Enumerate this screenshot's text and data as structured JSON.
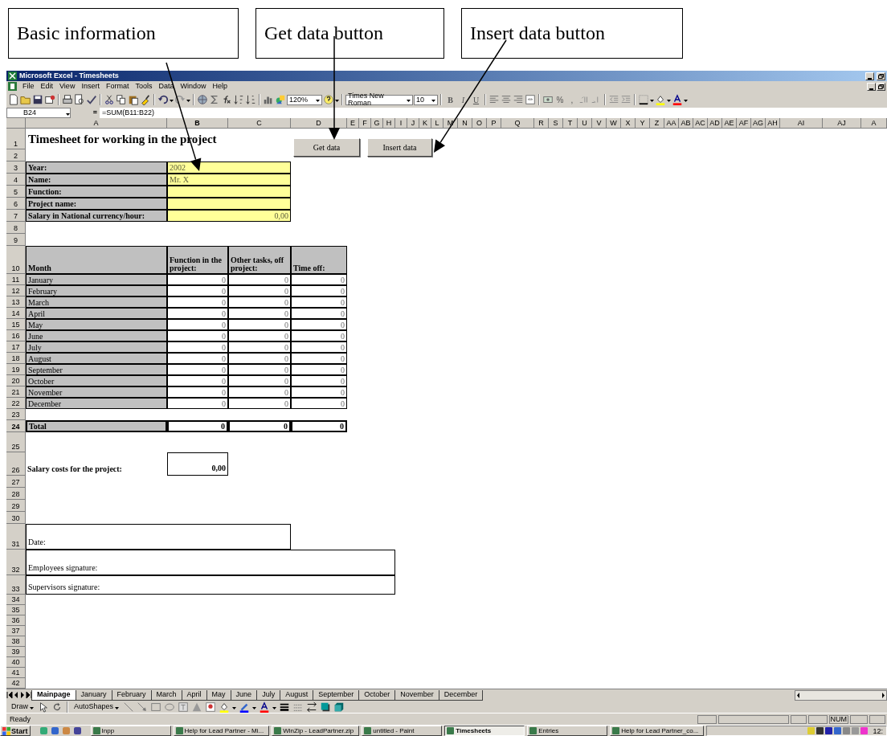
{
  "callouts": [
    {
      "text": "Basic information"
    },
    {
      "text": "Get data button"
    },
    {
      "text": "Insert data button"
    }
  ],
  "window": {
    "title": "Microsoft Excel - Timesheets"
  },
  "menu": [
    "File",
    "Edit",
    "View",
    "Insert",
    "Format",
    "Tools",
    "Data",
    "Window",
    "Help"
  ],
  "toolbar": {
    "zoom": "120%",
    "font": "Times New Roman",
    "font_size": "10",
    "format_buttons": [
      "B",
      "I",
      "U"
    ],
    "number_buttons": [
      "%",
      ","
    ]
  },
  "formula_bar": {
    "name_box": "B24",
    "equals": "=",
    "formula": "=SUM(B11:B22)"
  },
  "columns": [
    {
      "label": "A",
      "selected": false
    },
    {
      "label": "B",
      "selected": true
    },
    {
      "label": "C",
      "selected": false
    },
    {
      "label": "D",
      "selected": false
    },
    {
      "label": "E",
      "selected": false
    },
    {
      "label": "F",
      "selected": false
    },
    {
      "label": "G",
      "selected": false
    },
    {
      "label": "H",
      "selected": false
    },
    {
      "label": "I",
      "selected": false
    },
    {
      "label": "J",
      "selected": false
    },
    {
      "label": "K",
      "selected": false
    },
    {
      "label": "L",
      "selected": false
    },
    {
      "label": "M",
      "selected": false
    },
    {
      "label": "N",
      "selected": false
    },
    {
      "label": "O",
      "selected": false
    },
    {
      "label": "P",
      "selected": false
    },
    {
      "label": "Q",
      "selected": false
    },
    {
      "label": "R",
      "selected": false
    },
    {
      "label": "S",
      "selected": false
    },
    {
      "label": "T",
      "selected": false
    },
    {
      "label": "U",
      "selected": false
    },
    {
      "label": "V",
      "selected": false
    },
    {
      "label": "W",
      "selected": false
    },
    {
      "label": "X",
      "selected": false
    },
    {
      "label": "Y",
      "selected": false
    },
    {
      "label": "Z",
      "selected": false
    },
    {
      "label": "AA",
      "selected": false
    },
    {
      "label": "AB",
      "selected": false
    },
    {
      "label": "AC",
      "selected": false
    },
    {
      "label": "AD",
      "selected": false
    },
    {
      "label": "AE",
      "selected": false
    },
    {
      "label": "AF",
      "selected": false
    },
    {
      "label": "AG",
      "selected": false
    },
    {
      "label": "AH",
      "selected": false
    },
    {
      "label": "AI",
      "selected": false
    },
    {
      "label": "AJ",
      "selected": false
    },
    {
      "label": "A",
      "selected": false
    }
  ],
  "rows": [
    {
      "label": "1",
      "selected": false
    },
    {
      "label": "2",
      "selected": false
    },
    {
      "label": "3",
      "selected": false
    },
    {
      "label": "4",
      "selected": false
    },
    {
      "label": "5",
      "selected": false
    },
    {
      "label": "6",
      "selected": false
    },
    {
      "label": "7",
      "selected": false
    },
    {
      "label": "8",
      "selected": false
    },
    {
      "label": "9",
      "selected": false
    },
    {
      "label": "10",
      "selected": false
    },
    {
      "label": "11",
      "selected": false
    },
    {
      "label": "12",
      "selected": false
    },
    {
      "label": "13",
      "selected": false
    },
    {
      "label": "14",
      "selected": false
    },
    {
      "label": "15",
      "selected": false
    },
    {
      "label": "16",
      "selected": false
    },
    {
      "label": "17",
      "selected": false
    },
    {
      "label": "18",
      "selected": false
    },
    {
      "label": "19",
      "selected": false
    },
    {
      "label": "20",
      "selected": false
    },
    {
      "label": "21",
      "selected": false
    },
    {
      "label": "22",
      "selected": false
    },
    {
      "label": "23",
      "selected": false
    },
    {
      "label": "24",
      "selected": true
    },
    {
      "label": "25",
      "selected": false
    },
    {
      "label": "26",
      "selected": false
    },
    {
      "label": "27",
      "selected": false
    },
    {
      "label": "28",
      "selected": false
    },
    {
      "label": "29",
      "selected": false
    },
    {
      "label": "30",
      "selected": false
    },
    {
      "label": "31",
      "selected": false
    },
    {
      "label": "32",
      "selected": false
    },
    {
      "label": "33",
      "selected": false
    },
    {
      "label": "34",
      "selected": false
    },
    {
      "label": "35",
      "selected": false
    },
    {
      "label": "36",
      "selected": false
    },
    {
      "label": "37",
      "selected": false
    },
    {
      "label": "38",
      "selected": false
    },
    {
      "label": "39",
      "selected": false
    },
    {
      "label": "40",
      "selected": false
    },
    {
      "label": "41",
      "selected": false
    },
    {
      "label": "42",
      "selected": false
    }
  ],
  "sheet": {
    "title": "Timesheet for working in the project",
    "buttons": [
      "Get data",
      "Insert data"
    ],
    "info": [
      {
        "label": "Year:",
        "value": "2002"
      },
      {
        "label": "Name:",
        "value": "Mr. X"
      },
      {
        "label": "Function:"
      },
      {
        "label": "Project name:"
      },
      {
        "label": "Salary in National currency/hour:",
        "value": "0,00"
      }
    ],
    "table": {
      "columns": [
        "Month",
        "Function in the project:",
        "Other tasks, off project:",
        "Time off:"
      ],
      "rows": [
        {
          "month": "January",
          "values": [
            "0",
            "0",
            "0"
          ]
        },
        {
          "month": "February",
          "values": [
            "0",
            "0",
            "0"
          ]
        },
        {
          "month": "March",
          "values": [
            "0",
            "0",
            "0"
          ]
        },
        {
          "month": "April",
          "values": [
            "0",
            "0",
            "0"
          ]
        },
        {
          "month": "May",
          "values": [
            "0",
            "0",
            "0"
          ]
        },
        {
          "month": "June",
          "values": [
            "0",
            "0",
            "0"
          ]
        },
        {
          "month": "July",
          "values": [
            "0",
            "0",
            "0"
          ]
        },
        {
          "month": "August",
          "values": [
            "0",
            "0",
            "0"
          ]
        },
        {
          "month": "September",
          "values": [
            "0",
            "0",
            "0"
          ]
        },
        {
          "month": "October",
          "values": [
            "0",
            "0",
            "0"
          ]
        },
        {
          "month": "November",
          "values": [
            "0",
            "0",
            "0"
          ]
        },
        {
          "month": "December",
          "values": [
            "0",
            "0",
            "0"
          ]
        }
      ],
      "total": {
        "label": "Total",
        "values": [
          "0",
          "0",
          "0"
        ]
      }
    },
    "salary": {
      "label": "Salary costs for the project:",
      "value": "0,00"
    },
    "signatures": [
      "Date:",
      "Employees signature:",
      "Supervisors signature:"
    ]
  },
  "sheet_tabs": [
    {
      "label": "Mainpage",
      "selected": true
    },
    {
      "label": "January",
      "selected": false
    },
    {
      "label": "February",
      "selected": false
    },
    {
      "label": "March",
      "selected": false
    },
    {
      "label": "April",
      "selected": false
    },
    {
      "label": "May",
      "selected": false
    },
    {
      "label": "June",
      "selected": false
    },
    {
      "label": "July",
      "selected": false
    },
    {
      "label": "August",
      "selected": false
    },
    {
      "label": "September",
      "selected": false
    },
    {
      "label": "October",
      "selected": false
    },
    {
      "label": "November",
      "selected": false
    },
    {
      "label": "December",
      "selected": false
    }
  ],
  "draw_toolbar": {
    "draw": "Draw",
    "autoshapes": "AutoShapes"
  },
  "status_bar": {
    "text": "Ready",
    "indicator": "NUM"
  },
  "taskbar": {
    "start": "Start",
    "tasks": [
      {
        "label": "Inpp",
        "selected": false
      },
      {
        "label": "Help for Lead Partner - Mi...",
        "selected": false
      },
      {
        "label": "WinZip - LeadPartner.zip",
        "selected": false
      },
      {
        "label": "untitled - Paint",
        "selected": false
      },
      {
        "label": "Timesheets",
        "selected": true
      },
      {
        "label": "Entries",
        "selected": false
      },
      {
        "label": "Help for Lead Partner_co...",
        "selected": false
      }
    ],
    "clock": "12:"
  }
}
